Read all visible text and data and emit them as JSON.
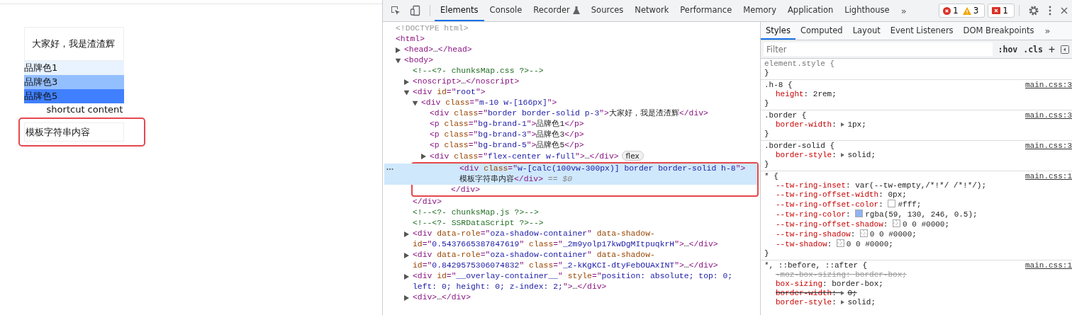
{
  "page": {
    "card_text": "大家好，我是渣渣辉",
    "brand_rows": [
      {
        "label": "品牌色1",
        "color": "#e8f3ff"
      },
      {
        "label": "品牌色3",
        "color": "#94bfff"
      },
      {
        "label": "品牌色5",
        "color": "#4080ff"
      }
    ],
    "shortcut_text": "shortcut content",
    "template_box": {
      "text": "模板字符串内容",
      "annotated": true
    }
  },
  "toolbar": {
    "tabs": [
      {
        "label": "Elements",
        "selected": true,
        "has_icon": false
      },
      {
        "label": "Console",
        "selected": false,
        "has_icon": false
      },
      {
        "label": "Recorder",
        "selected": false,
        "has_icon": true
      },
      {
        "label": "Sources",
        "selected": false,
        "has_icon": false
      },
      {
        "label": "Network",
        "selected": false,
        "has_icon": false
      },
      {
        "label": "Performance",
        "selected": false,
        "has_icon": false
      },
      {
        "label": "Memory",
        "selected": false,
        "has_icon": false
      },
      {
        "label": "Application",
        "selected": false,
        "has_icon": false
      },
      {
        "label": "Lighthouse",
        "selected": false,
        "has_icon": false
      }
    ],
    "overflow": "»",
    "counters": [
      {
        "kind": "error",
        "count": "1"
      },
      {
        "kind": "warning",
        "count": "3"
      }
    ],
    "issues": "1"
  },
  "elements": {
    "nodes": [
      {
        "selected": false,
        "tokens": [
          {
            "kind": "doctype",
            "text": "<!DOCTYPE html>"
          }
        ]
      },
      {
        "selected": false,
        "tokens": [
          {
            "kind": "tag",
            "text": "<html>"
          }
        ],
        "children": [
          {
            "selected": false,
            "expanded": false,
            "tokens": [
              {
                "kind": "tag",
                "text": "<head>"
              },
              {
                "kind": "text",
                "text": "…"
              },
              {
                "kind": "tag",
                "text": "</head>"
              }
            ]
          },
          {
            "selected": false,
            "expanded": true,
            "tokens": [
              {
                "kind": "tag",
                "text": "<body>"
              }
            ],
            "children": [
              {
                "selected": false,
                "tokens": [
                  {
                    "kind": "comment",
                    "text": "<!--<?- chunksMap.css ?>-->"
                  }
                ]
              },
              {
                "selected": false,
                "expanded": false,
                "tokens": [
                  {
                    "kind": "tag",
                    "text": "<noscript>"
                  },
                  {
                    "kind": "text",
                    "text": "…"
                  },
                  {
                    "kind": "tag",
                    "text": "</noscript>"
                  }
                ]
              },
              {
                "selected": false,
                "expanded": true,
                "tokens": [
                  {
                    "kind": "tag",
                    "text": "<div"
                  },
                  {
                    "kind": "attr",
                    "text": " id"
                  },
                  {
                    "kind": "tag",
                    "text": "=\""
                  },
                  {
                    "kind": "value",
                    "text": "root"
                  },
                  {
                    "kind": "tag",
                    "text": "\">"
                  }
                ],
                "close": [
                  {
                    "kind": "tag",
                    "text": "</div>"
                  }
                ],
                "children": [
                  {
                    "selected": false,
                    "expanded": true,
                    "close_boxed": true,
                    "tokens": [
                      {
                        "kind": "tag",
                        "text": "<div"
                      },
                      {
                        "kind": "attr",
                        "text": " class"
                      },
                      {
                        "kind": "tag",
                        "text": "=\""
                      },
                      {
                        "kind": "value",
                        "text": "m-10 w-[166px]"
                      },
                      {
                        "kind": "tag",
                        "text": "\">"
                      }
                    ],
                    "close": [
                      {
                        "kind": "tag",
                        "text": "</div>"
                      }
                    ],
                    "children": [
                      {
                        "selected": false,
                        "tokens": [
                          {
                            "kind": "tag",
                            "text": "<div"
                          },
                          {
                            "kind": "attr",
                            "text": " class"
                          },
                          {
                            "kind": "tag",
                            "text": "=\""
                          },
                          {
                            "kind": "value",
                            "text": "border border-solid p-3"
                          },
                          {
                            "kind": "tag",
                            "text": "\">"
                          },
                          {
                            "kind": "text",
                            "text": "大家好，我是渣渣辉"
                          },
                          {
                            "kind": "tag",
                            "text": "</div>"
                          }
                        ]
                      },
                      {
                        "selected": false,
                        "tokens": [
                          {
                            "kind": "tag",
                            "text": "<p"
                          },
                          {
                            "kind": "attr",
                            "text": " class"
                          },
                          {
                            "kind": "tag",
                            "text": "=\""
                          },
                          {
                            "kind": "value",
                            "text": "bg-brand-1"
                          },
                          {
                            "kind": "tag",
                            "text": "\">"
                          },
                          {
                            "kind": "text",
                            "text": "品牌色1"
                          },
                          {
                            "kind": "tag",
                            "text": "</p>"
                          }
                        ]
                      },
                      {
                        "selected": false,
                        "tokens": [
                          {
                            "kind": "tag",
                            "text": "<p"
                          },
                          {
                            "kind": "attr",
                            "text": " class"
                          },
                          {
                            "kind": "tag",
                            "text": "=\""
                          },
                          {
                            "kind": "value",
                            "text": "bg-brand-3"
                          },
                          {
                            "kind": "tag",
                            "text": "\">"
                          },
                          {
                            "kind": "text",
                            "text": "品牌色3"
                          },
                          {
                            "kind": "tag",
                            "text": "</p>"
                          }
                        ]
                      },
                      {
                        "selected": false,
                        "tokens": [
                          {
                            "kind": "tag",
                            "text": "<p"
                          },
                          {
                            "kind": "attr",
                            "text": " class"
                          },
                          {
                            "kind": "tag",
                            "text": "=\""
                          },
                          {
                            "kind": "value",
                            "text": "bg-brand-5"
                          },
                          {
                            "kind": "tag",
                            "text": "\">"
                          },
                          {
                            "kind": "text",
                            "text": "品牌色5"
                          },
                          {
                            "kind": "tag",
                            "text": "</p>"
                          }
                        ]
                      },
                      {
                        "selected": false,
                        "expanded": false,
                        "badge": "flex",
                        "tokens": [
                          {
                            "kind": "tag",
                            "text": "<div"
                          },
                          {
                            "kind": "attr",
                            "text": " class"
                          },
                          {
                            "kind": "tag",
                            "text": "=\""
                          },
                          {
                            "kind": "value",
                            "text": "flex-center w-full"
                          },
                          {
                            "kind": "tag",
                            "text": "\">"
                          },
                          {
                            "kind": "text",
                            "text": "…"
                          },
                          {
                            "kind": "tag",
                            "text": "</div>"
                          }
                        ]
                      },
                      {
                        "selected": true,
                        "boxed": true,
                        "tokens": [
                          {
                            "kind": "tag",
                            "text": "<div"
                          },
                          {
                            "kind": "attr",
                            "text": " class"
                          },
                          {
                            "kind": "tag",
                            "text": "=\""
                          },
                          {
                            "kind": "value",
                            "text": "w-[calc(100vw-300px)] border border-solid h-8"
                          },
                          {
                            "kind": "tag",
                            "text": "\">"
                          },
                          {
                            "kind": "text",
                            "text": "模板字符串内容"
                          },
                          {
                            "kind": "tag",
                            "text": "</div>"
                          },
                          {
                            "kind": "hint",
                            "text": " == $0"
                          }
                        ]
                      }
                    ]
                  }
                ]
              },
              {
                "selected": false,
                "tokens": [
                  {
                    "kind": "comment",
                    "text": "<!--<?- chunksMap.js ?>-->"
                  }
                ]
              },
              {
                "selected": false,
                "tokens": [
                  {
                    "kind": "comment",
                    "text": "<!--<?- SSRDataScript ?>-->"
                  }
                ]
              },
              {
                "selected": false,
                "expanded": false,
                "tokens": [
                  {
                    "kind": "tag",
                    "text": "<div"
                  },
                  {
                    "kind": "attr",
                    "text": " data-role"
                  },
                  {
                    "kind": "tag",
                    "text": "=\""
                  },
                  {
                    "kind": "value",
                    "text": "oza-shadow-container"
                  },
                  {
                    "kind": "tag",
                    "text": "\""
                  },
                  {
                    "kind": "attr",
                    "text": " data-shadow-id"
                  },
                  {
                    "kind": "tag",
                    "text": "=\""
                  },
                  {
                    "kind": "value",
                    "text": "0.5437665387847619"
                  },
                  {
                    "kind": "tag",
                    "text": "\""
                  },
                  {
                    "kind": "attr",
                    "text": " class"
                  },
                  {
                    "kind": "tag",
                    "text": "=\""
                  },
                  {
                    "kind": "value",
                    "text": "_2m9yolp17kwDgMItpuqkrH"
                  },
                  {
                    "kind": "tag",
                    "text": "\">"
                  },
                  {
                    "kind": "text",
                    "text": "…"
                  },
                  {
                    "kind": "tag",
                    "text": "</div>"
                  }
                ]
              },
              {
                "selected": false,
                "expanded": false,
                "tokens": [
                  {
                    "kind": "tag",
                    "text": "<div"
                  },
                  {
                    "kind": "attr",
                    "text": " data-role"
                  },
                  {
                    "kind": "tag",
                    "text": "=\""
                  },
                  {
                    "kind": "value",
                    "text": "oza-shadow-container"
                  },
                  {
                    "kind": "tag",
                    "text": "\""
                  },
                  {
                    "kind": "attr",
                    "text": " data-shadow-id"
                  },
                  {
                    "kind": "tag",
                    "text": "=\""
                  },
                  {
                    "kind": "value",
                    "text": "0.8429575306074832"
                  },
                  {
                    "kind": "tag",
                    "text": "\""
                  },
                  {
                    "kind": "attr",
                    "text": " class"
                  },
                  {
                    "kind": "tag",
                    "text": "=\""
                  },
                  {
                    "kind": "value",
                    "text": "_2-kKgKCI-dtyFebOUAxINT"
                  },
                  {
                    "kind": "tag",
                    "text": "\">"
                  },
                  {
                    "kind": "text",
                    "text": "…"
                  },
                  {
                    "kind": "tag",
                    "text": "</div>"
                  }
                ]
              },
              {
                "selected": false,
                "expanded": false,
                "tokens": [
                  {
                    "kind": "tag",
                    "text": "<div"
                  },
                  {
                    "kind": "attr",
                    "text": " id"
                  },
                  {
                    "kind": "tag",
                    "text": "=\""
                  },
                  {
                    "kind": "value",
                    "text": "__overlay-container__"
                  },
                  {
                    "kind": "tag",
                    "text": "\""
                  },
                  {
                    "kind": "attr",
                    "text": " style"
                  },
                  {
                    "kind": "tag",
                    "text": "=\""
                  },
                  {
                    "kind": "value",
                    "text": "position: absolute; top: 0; left: 0; height: 0; z-index: 2;"
                  },
                  {
                    "kind": "tag",
                    "text": "\">"
                  },
                  {
                    "kind": "text",
                    "text": "…"
                  },
                  {
                    "kind": "tag",
                    "text": "</div>"
                  }
                ]
              },
              {
                "selected": false,
                "expanded": false,
                "tokens": [
                  {
                    "kind": "tag",
                    "text": "<div>"
                  },
                  {
                    "kind": "text",
                    "text": "…"
                  },
                  {
                    "kind": "tag",
                    "text": "</div>"
                  }
                ]
              }
            ]
          }
        ]
      }
    ]
  },
  "styles": {
    "tabs": [
      {
        "label": "Styles",
        "selected": true
      },
      {
        "label": "Computed",
        "selected": false
      },
      {
        "label": "Layout",
        "selected": false
      },
      {
        "label": "Event Listeners",
        "selected": false
      },
      {
        "label": "DOM Breakpoints",
        "selected": false
      }
    ],
    "overflow": "»",
    "filter": {
      "placeholder": "Filter"
    },
    "hov": ":hov",
    "cls": ".cls",
    "add": "+",
    "rules": [
      {
        "selector": "element.style",
        "brace": "{",
        "muted": true,
        "close": "}"
      },
      {
        "selector": ".h-8",
        "brace": "{",
        "muted": false,
        "source": "main.css:3",
        "close": "}",
        "declarations": [
          {
            "name": "height",
            "colon": ":",
            "value": "2rem;",
            "struck": false,
            "expandable": false
          }
        ]
      },
      {
        "selector": ".border",
        "brace": "{",
        "muted": false,
        "source": "main.css:3",
        "close": "}",
        "declarations": [
          {
            "name": "border-width",
            "colon": ":",
            "value": "1px;",
            "struck": false,
            "expandable": true
          }
        ]
      },
      {
        "selector": ".border-solid",
        "brace": "{",
        "muted": false,
        "source": "main.css:3",
        "close": "}",
        "declarations": [
          {
            "name": "border-style",
            "colon": ":",
            "value": "solid;",
            "struck": false,
            "expandable": true
          }
        ]
      },
      {
        "selector": "*",
        "brace": "{",
        "muted": false,
        "source": "main.css:1",
        "close": "}",
        "declarations": [
          {
            "name": "--tw-ring-inset",
            "colon": ":",
            "value": "var(--tw-empty,/*!*/ /*!*/);",
            "struck": false,
            "expandable": false
          },
          {
            "name": "--tw-ring-offset-width",
            "colon": ":",
            "value": "0px;",
            "struck": false,
            "expandable": false
          },
          {
            "name": "--tw-ring-offset-color",
            "colon": ":",
            "value": "#fff;",
            "struck": false,
            "expandable": false,
            "swatch": {
              "kind": "solid",
              "color": "#ffffff"
            }
          },
          {
            "name": "--tw-ring-color",
            "colon": ":",
            "value": "rgba(59, 130, 246, 0.5);",
            "struck": false,
            "expandable": false,
            "swatch": {
              "kind": "solid",
              "color": "#8fb4f2"
            }
          },
          {
            "name": "--tw-ring-offset-shadow",
            "colon": ":",
            "value": "0 0 #0000;",
            "struck": false,
            "expandable": false,
            "swatch": {
              "kind": "checker"
            }
          },
          {
            "name": "--tw-ring-shadow",
            "colon": ":",
            "value": "0 0 #0000;",
            "struck": false,
            "expandable": false,
            "swatch": {
              "kind": "checker"
            }
          },
          {
            "name": "--tw-shadow",
            "colon": ":",
            "value": "0 0 #0000;",
            "struck": false,
            "expandable": false,
            "swatch": {
              "kind": "checker"
            }
          }
        ]
      },
      {
        "selector": "*, ::before, ::after",
        "brace": "{",
        "muted": false,
        "source": "main.css:1",
        "declarations": [
          {
            "name": "-moz-box-sizing",
            "colon": ":",
            "value": "border-box;",
            "struck": true,
            "expandable": false,
            "inactive": true
          },
          {
            "name": "box-sizing",
            "colon": ":",
            "value": "border-box;",
            "struck": false,
            "expandable": false
          },
          {
            "name": "border-width",
            "colon": ":",
            "value": "0;",
            "struck": true,
            "expandable": true
          },
          {
            "name": "border-style",
            "colon": ":",
            "value": "solid;",
            "struck": false,
            "expandable": true
          }
        ]
      }
    ]
  }
}
